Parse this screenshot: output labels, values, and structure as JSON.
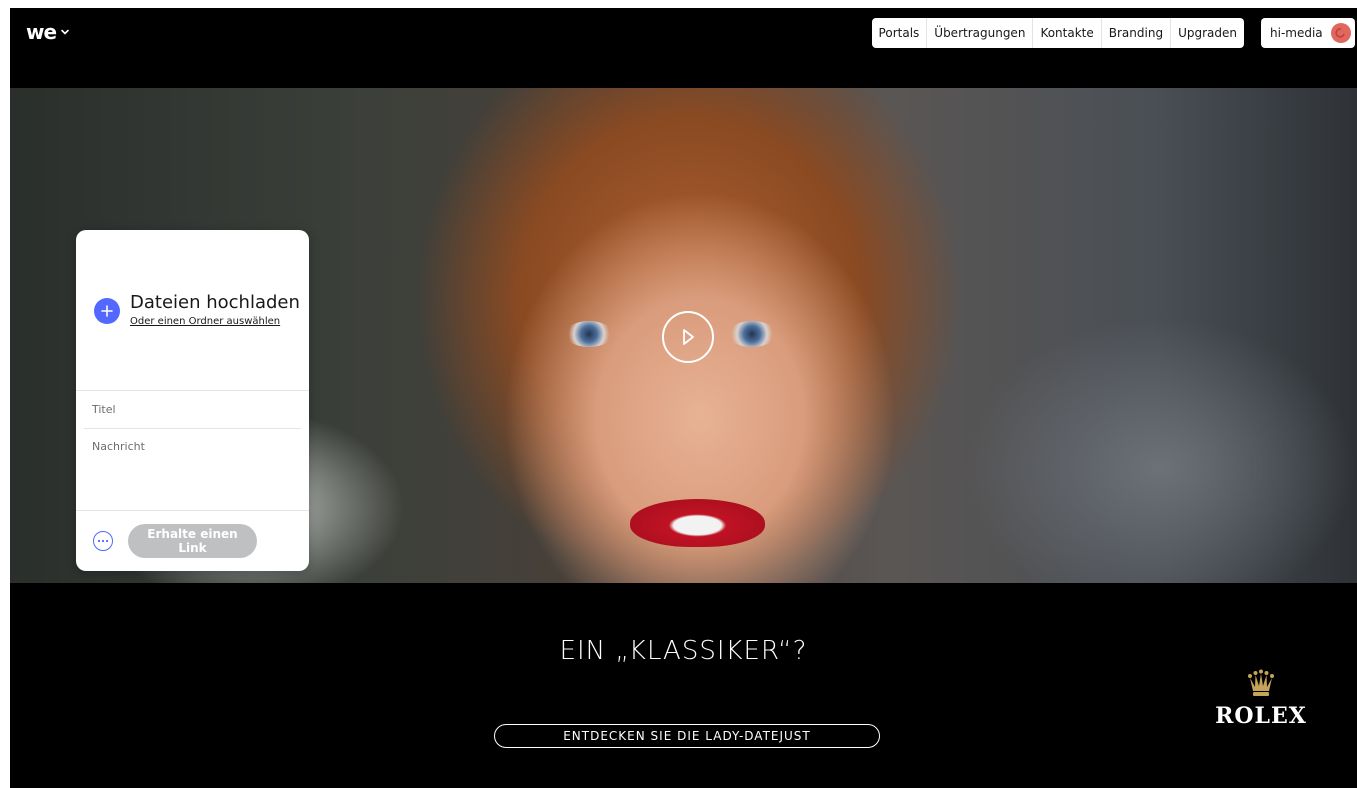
{
  "logo": {
    "text": "we"
  },
  "nav": {
    "items": [
      "Portals",
      "Übertragungen",
      "Kontakte",
      "Branding",
      "Upgraden"
    ],
    "account_label": "hi-media"
  },
  "upload_card": {
    "title": "Dateien hochladen",
    "subtitle": "Oder einen Ordner auswählen",
    "title_placeholder": "Titel",
    "message_placeholder": "Nachricht",
    "link_button_line1": "Erhalte einen",
    "link_button_line2": "Link"
  },
  "ad": {
    "headline": "EIN „KLASSIKER“?",
    "cta": "ENTDECKEN SIE DIE LADY-DATEJUST",
    "brand": "ROLEX"
  },
  "colors": {
    "accent": "#5268ff",
    "avatar": "#e0665e",
    "button_disabled": "#bfc0c2",
    "brand_gold": "#c5a45a"
  },
  "icons": {
    "logo_chevron": "chevron-down-icon",
    "play": "play-icon",
    "add": "plus-icon",
    "more": "more-options-icon",
    "crown": "rolex-crown-icon"
  }
}
